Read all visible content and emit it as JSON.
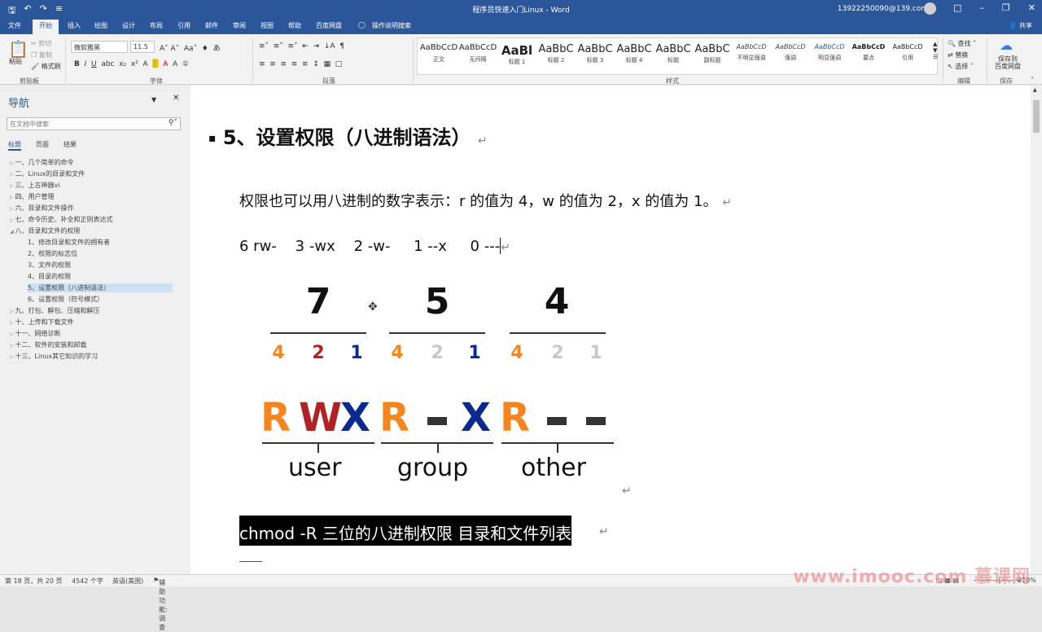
{
  "titlebar": {
    "title": "程序员快速入门Linux - Word",
    "account": "13922250090@139.com"
  },
  "tabs": [
    "文件",
    "开始",
    "插入",
    "绘图",
    "设计",
    "布局",
    "引用",
    "邮件",
    "审阅",
    "视图",
    "帮助",
    "百度网盘",
    "操作说明搜索"
  ],
  "share_label": "共享",
  "ribbon": {
    "clipboard": {
      "paste": "粘贴",
      "cut": "剪切",
      "copy": "复制",
      "format_painter": "格式刷",
      "label": "剪贴板"
    },
    "font": {
      "font_name": "微软雅黑",
      "font_size": "11.5",
      "label": "字体"
    },
    "paragraph_label": "段落",
    "styles": {
      "label": "样式",
      "items": [
        {
          "sample": "AaBbCcD",
          "name": "正文"
        },
        {
          "sample": "AaBbCcD",
          "name": "无间隔"
        },
        {
          "sample": "AaBl",
          "name": "标题 1"
        },
        {
          "sample": "AaBbC",
          "name": "标题 2"
        },
        {
          "sample": "AaBbC",
          "name": "标题 3"
        },
        {
          "sample": "AaBbC",
          "name": "标题 4"
        },
        {
          "sample": "AaBbC",
          "name": "标题"
        },
        {
          "sample": "AaBbC",
          "name": "副标题"
        },
        {
          "sample": "AaBbCcD",
          "name": "不明显强调"
        },
        {
          "sample": "AaBbCcD",
          "name": "强调"
        },
        {
          "sample": "AaBbCcD",
          "name": "明显强调"
        },
        {
          "sample": "AaBbCcD",
          "name": "要点"
        },
        {
          "sample": "AaBbCcD",
          "name": "引用"
        }
      ]
    },
    "editing": {
      "find": "查找",
      "replace": "替换",
      "select": "选择",
      "label": "编辑"
    },
    "save": {
      "button": "保存到\n百度网盘",
      "label": "保存"
    }
  },
  "nav": {
    "title": "导航",
    "search_placeholder": "在文档中搜索",
    "tabs": [
      "标题",
      "页面",
      "结果"
    ],
    "items": [
      {
        "text": "一、几个简单的命令",
        "level": 1
      },
      {
        "text": "二、Linux的目录和文件",
        "level": 1
      },
      {
        "text": "三、上古神器vi",
        "level": 1
      },
      {
        "text": "四、用户管理",
        "level": 1
      },
      {
        "text": "六、目录和文件操作",
        "level": 1
      },
      {
        "text": "七、命令历史、补全和正则表达式",
        "level": 1
      },
      {
        "text": "八、目录和文件的权限",
        "level": 1
      },
      {
        "text": "1、修改目录和文件的拥有者",
        "level": 2
      },
      {
        "text": "2、权限的标志位",
        "level": 2
      },
      {
        "text": "3、文件的权限",
        "level": 2
      },
      {
        "text": "4、目录的权限",
        "level": 2
      },
      {
        "text": "5、设置权限（八进制语法）",
        "level": 2,
        "selected": true
      },
      {
        "text": "6、设置权限（符号模式）",
        "level": 2
      },
      {
        "text": "九、打包、解包、压缩和解压",
        "level": 1
      },
      {
        "text": "十、上传和下载文件",
        "level": 1
      },
      {
        "text": "十一、网络诊断",
        "level": 1
      },
      {
        "text": "十二、软件的安装和卸载",
        "level": 1
      },
      {
        "text": "十三、Linux其它知识的学习",
        "level": 1
      }
    ]
  },
  "document": {
    "heading": "5、设置权限（八进制语法）",
    "para1": "权限也可以用八进制的数字表示：r 的值为 4，w 的值为 2，x 的值为 1。",
    "para2": "6 rw-    3 -wx    2 -w-     1 --x     0 ---",
    "diagram": {
      "octal": [
        "7",
        "5",
        "4"
      ],
      "bits": [
        "4",
        "2",
        "1"
      ],
      "letters_user": [
        "R",
        "W",
        "X"
      ],
      "letters_group": [
        "R",
        "-",
        "X"
      ],
      "letters_other": [
        "R",
        "-",
        "-"
      ],
      "owners": [
        "user",
        "group",
        "other"
      ],
      "colors": {
        "r": "#f7851f",
        "w": "#b22222",
        "x": "#0a2a8f",
        "off": "#c8c8c8",
        "dash": "#333333"
      }
    },
    "command": "chmod -R  三位的八进制权限 目录和文件列表"
  },
  "statusbar": {
    "page": "第 18 页，共 20 页",
    "words": "4542 个字",
    "language": "英语(美国)",
    "accessibility": "辅助功能: 调查",
    "zoom": "210%"
  },
  "watermark": "www.imooc.com  慕课网"
}
